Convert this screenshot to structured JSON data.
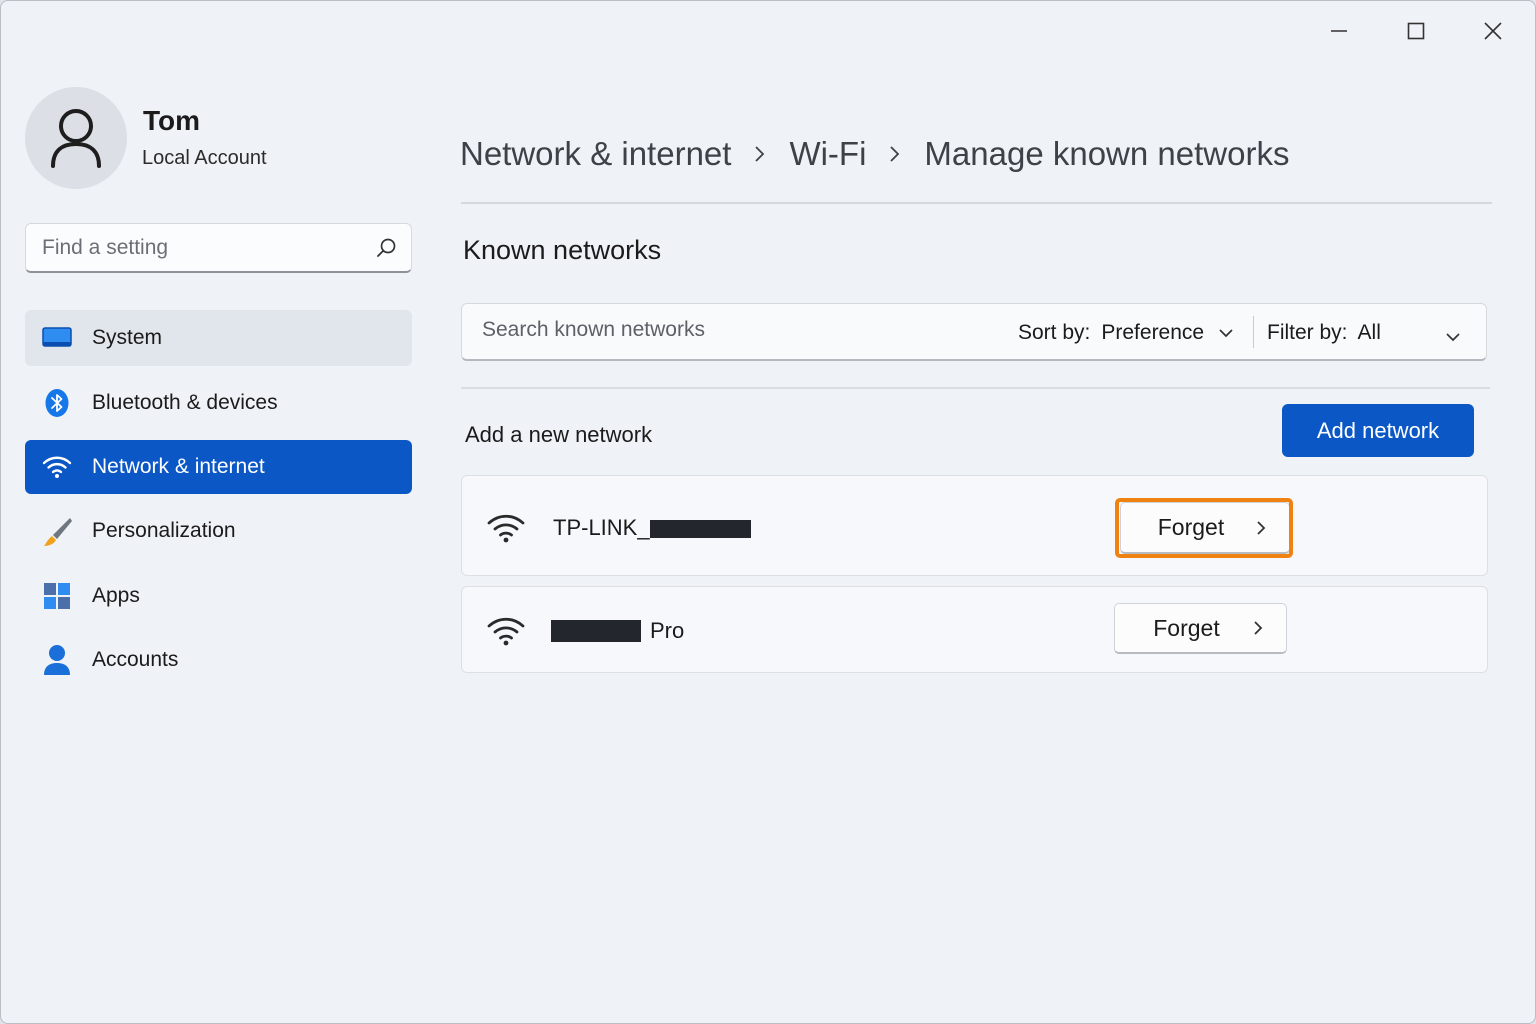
{
  "window": {
    "controls": {
      "minimize": "minimize-icon",
      "maximize": "maximize-icon",
      "close": "close-icon"
    }
  },
  "user": {
    "name": "Tom",
    "account_type": "Local Account",
    "avatar_icon": "person-icon"
  },
  "search": {
    "placeholder": "Find a setting",
    "icon": "search-icon"
  },
  "sidebar": {
    "items": [
      {
        "label": "System",
        "icon": "monitor-icon",
        "state": "hover"
      },
      {
        "label": "Bluetooth & devices",
        "icon": "bluetooth-icon",
        "state": "normal"
      },
      {
        "label": "Network & internet",
        "icon": "wifi-icon",
        "state": "selected"
      },
      {
        "label": "Personalization",
        "icon": "brush-icon",
        "state": "normal"
      },
      {
        "label": "Apps",
        "icon": "apps-icon",
        "state": "normal"
      },
      {
        "label": "Accounts",
        "icon": "person-icon",
        "state": "normal"
      }
    ]
  },
  "breadcrumb": {
    "items": [
      "Network & internet",
      "Wi-Fi",
      "Manage known networks"
    ]
  },
  "known_networks": {
    "title": "Known networks",
    "search_placeholder": "Search known networks",
    "sort_label": "Sort by:",
    "sort_value": "Preference",
    "filter_label": "Filter by:",
    "filter_value": "All",
    "add_label": "Add a new network",
    "add_button": "Add network",
    "networks": [
      {
        "ssid_prefix": "TP-LINK_",
        "ssid_suffix": "",
        "redacted": true,
        "forget_label": "Forget",
        "highlighted": true
      },
      {
        "ssid_prefix": "",
        "ssid_suffix": "Pro",
        "redacted": true,
        "forget_label": "Forget",
        "highlighted": false
      }
    ]
  },
  "colors": {
    "accent": "#0a57c5",
    "highlight": "#f08212",
    "background": "#eff2f7"
  }
}
